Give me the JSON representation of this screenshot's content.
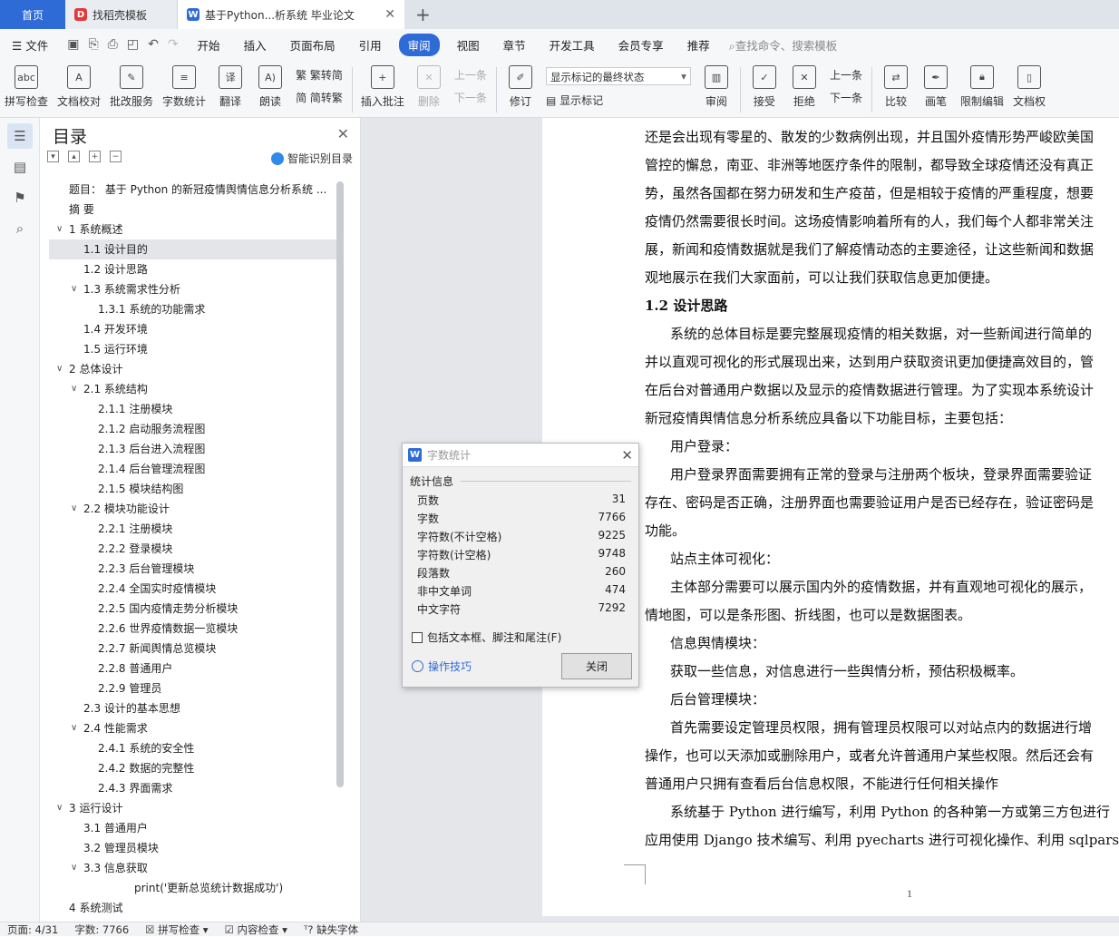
{
  "tabs": [
    {
      "label": "首页",
      "icon": "home-tab"
    },
    {
      "label": "找稻壳模板",
      "icon": "docer-icon"
    },
    {
      "label": "基于Python...析系统 毕业论文",
      "icon": "wps-writer-icon"
    }
  ],
  "menu": {
    "file": "文件",
    "items": [
      "开始",
      "插入",
      "页面布局",
      "引用",
      "审阅",
      "视图",
      "章节",
      "开发工具",
      "会员专享",
      "推荐"
    ],
    "active": "审阅",
    "search_placeholder": "查找命令、搜索模板"
  },
  "ribbon": {
    "spell_check": "拼写检查",
    "doc_proof": "文档校对",
    "batch_service": "批改服务",
    "word_count": "字数统计",
    "translate": "翻译",
    "read_aloud": "朗读",
    "trad_to_simp": "繁转简",
    "simp_to_trad": "简转繁",
    "insert_comment": "插入批注",
    "delete": "删除",
    "prev_comment": "上一条",
    "next_comment": "下一条",
    "track_changes": "修订",
    "markup_select": "显示标记的最终状态",
    "show_markup": "显示标记",
    "review": "审阅",
    "accept": "接受",
    "reject": "拒绝",
    "prev_change": "上一条",
    "next_change": "下一条",
    "compare": "比较",
    "pen": "画笔",
    "restrict_edit": "限制编辑",
    "doc_right": "文档权"
  },
  "toc": {
    "title": "目录",
    "smart_label": "智能识别目录",
    "items": [
      {
        "text": "题目： 基于 Python 的新冠疫情舆情信息分析系统 ...",
        "level": 0,
        "arrow": ""
      },
      {
        "text": "摘   要",
        "level": 0,
        "arrow": ""
      },
      {
        "text": "1   系统概述",
        "level": 0,
        "arrow": "v"
      },
      {
        "text": "1.1   设计目的",
        "level": 1,
        "arrow": "",
        "selected": true
      },
      {
        "text": "1.2  设计思路",
        "level": 1,
        "arrow": ""
      },
      {
        "text": "1.3  系统需求性分析",
        "level": 1,
        "arrow": "v"
      },
      {
        "text": "1.3.1  系统的功能需求",
        "level": 2,
        "arrow": ""
      },
      {
        "text": "1.4  开发环境",
        "level": 1,
        "arrow": ""
      },
      {
        "text": "1.5  运行环境",
        "level": 1,
        "arrow": ""
      },
      {
        "text": "2  总体设计",
        "level": 0,
        "arrow": "v"
      },
      {
        "text": "2.1 系统结构",
        "level": 1,
        "arrow": "v"
      },
      {
        "text": "2.1.1 注册模块",
        "level": 2,
        "arrow": ""
      },
      {
        "text": "2.1.2 启动服务流程图",
        "level": 2,
        "arrow": ""
      },
      {
        "text": "2.1.3 后台进入流程图",
        "level": 2,
        "arrow": ""
      },
      {
        "text": "2.1.4 后台管理流程图",
        "level": 2,
        "arrow": ""
      },
      {
        "text": "2.1.5 模块结构图",
        "level": 2,
        "arrow": ""
      },
      {
        "text": "2.2 模块功能设计",
        "level": 1,
        "arrow": "v"
      },
      {
        "text": "2.2.1 注册模块",
        "level": 2,
        "arrow": ""
      },
      {
        "text": "2.2.2 登录模块",
        "level": 2,
        "arrow": ""
      },
      {
        "text": "2.2.3 后台管理模块",
        "level": 2,
        "arrow": ""
      },
      {
        "text": "2.2.4 全国实时疫情模块",
        "level": 2,
        "arrow": ""
      },
      {
        "text": "2.2.5 国内疫情走势分析模块",
        "level": 2,
        "arrow": ""
      },
      {
        "text": "2.2.6 世界疫情数据一览模块",
        "level": 2,
        "arrow": ""
      },
      {
        "text": "2.2.7 新闻舆情总览模块",
        "level": 2,
        "arrow": ""
      },
      {
        "text": "2.2.8 普通用户",
        "level": 2,
        "arrow": ""
      },
      {
        "text": "2.2.9 管理员",
        "level": 2,
        "arrow": ""
      },
      {
        "text": "2.3 设计的基本思想",
        "level": 1,
        "arrow": ""
      },
      {
        "text": "2.4 性能需求",
        "level": 1,
        "arrow": "v"
      },
      {
        "text": "2.4.1 系统的安全性",
        "level": 2,
        "arrow": ""
      },
      {
        "text": "2.4.2 数据的完整性",
        "level": 2,
        "arrow": ""
      },
      {
        "text": "2.4.3 界面需求",
        "level": 2,
        "arrow": ""
      },
      {
        "text": "3  运行设计",
        "level": 0,
        "arrow": "v"
      },
      {
        "text": "3.1  普通用户",
        "level": 1,
        "arrow": ""
      },
      {
        "text": "3.2  管理员模块",
        "level": 1,
        "arrow": ""
      },
      {
        "text": "3.3  信息获取",
        "level": 1,
        "arrow": "v"
      },
      {
        "text": "print('更新总览统计数据成功')",
        "level": 3,
        "arrow": ""
      },
      {
        "text": "4  系统测试",
        "level": 0,
        "arrow": ""
      }
    ]
  },
  "document": {
    "lines": [
      {
        "text": "还是会出现有零星的、散发的少数病例出现，并且国外疫情形势严峻欧美国",
        "indent": false,
        "heading": false
      },
      {
        "text": "管控的懈怠，南亚、非洲等地医疗条件的限制，都导致全球疫情还没有真正",
        "indent": false,
        "heading": false
      },
      {
        "text": "势，虽然各国都在努力研发和生产疫苗，但是相较于疫情的严重程度，想要",
        "indent": false,
        "heading": false
      },
      {
        "text": "疫情仍然需要很长时间。这场疫情影响着所有的人，我们每个人都非常关注",
        "indent": false,
        "heading": false
      },
      {
        "text": "展，新闻和疫情数据就是我们了解疫情动态的主要途径，让这些新闻和数据",
        "indent": false,
        "heading": false
      },
      {
        "text": "观地展示在我们大家面前，可以让我们获取信息更加便捷。",
        "indent": false,
        "heading": false
      },
      {
        "text": "1.2  设计思路",
        "indent": false,
        "heading": true
      },
      {
        "text": " 系统的总体目标是要完整展现疫情的相关数据，对一些新闻进行简单的",
        "indent": true,
        "heading": false
      },
      {
        "text": "并以直观可视化的形式展现出来，达到用户获取资讯更加便捷高效目的，管",
        "indent": false,
        "heading": false
      },
      {
        "text": "在后台对普通用户数据以及显示的疫情数据进行管理。为了实现本系统设计",
        "indent": false,
        "heading": false
      },
      {
        "text": "新冠疫情舆情信息分析系统应具备以下功能目标，主要包括：",
        "indent": false,
        "heading": false
      },
      {
        "text": "用户登录：",
        "indent": true,
        "heading": false
      },
      {
        "text": "用户登录界面需要拥有正常的登录与注册两个板块，登录界面需要验证",
        "indent": true,
        "heading": false
      },
      {
        "text": "存在、密码是否正确，注册界面也需要验证用户是否已经存在，验证密码是",
        "indent": false,
        "heading": false
      },
      {
        "text": "功能。",
        "indent": false,
        "heading": false
      },
      {
        "text": "站点主体可视化：",
        "indent": true,
        "heading": false
      },
      {
        "text": "主体部分需要可以展示国内外的疫情数据，并有直观地可视化的展示，",
        "indent": true,
        "heading": false
      },
      {
        "text": "情地图，可以是条形图、折线图，也可以是数据图表。",
        "indent": false,
        "heading": false
      },
      {
        "text": "信息舆情模块：",
        "indent": true,
        "heading": false
      },
      {
        "text": "获取一些信息，对信息进行一些舆情分析，预估积极概率。",
        "indent": true,
        "heading": false
      },
      {
        "text": "后台管理模块：",
        "indent": true,
        "heading": false
      },
      {
        "text": "首先需要设定管理员权限，拥有管理员权限可以对站点内的数据进行增",
        "indent": true,
        "heading": false
      },
      {
        "text": "操作，也可以天添加或删除用户，或者允许普通用户某些权限。然后还会有",
        "indent": false,
        "heading": false
      },
      {
        "text": "普通用户只拥有查看后台信息权限，不能进行任何相关操作",
        "indent": false,
        "heading": false
      },
      {
        "text": "系统基于 Python 进行编写，利用 Python 的各种第一方或第三方包进行",
        "indent": true,
        "heading": false
      },
      {
        "text": "应用使用 Django 技术编写、利用 pyecharts 进行可视化操作、利用 sqlparse",
        "indent": false,
        "heading": false
      }
    ],
    "page_number": "1"
  },
  "dialog": {
    "title": "字数统计",
    "section": "统计信息",
    "rows": [
      {
        "label": "页数",
        "value": "31"
      },
      {
        "label": "字数",
        "value": "7766"
      },
      {
        "label": "字符数(不计空格)",
        "value": "9225"
      },
      {
        "label": "字符数(计空格)",
        "value": "9748"
      },
      {
        "label": "段落数",
        "value": "260"
      },
      {
        "label": "非中文单词",
        "value": "474"
      },
      {
        "label": "中文字符",
        "value": "7292"
      }
    ],
    "checkbox_label": "包括文本框、脚注和尾注(F)",
    "tips_label": "操作技巧",
    "close_label": "关闭"
  },
  "status": {
    "page": "页面: 4/31",
    "words": "字数: 7766",
    "spell": "拼写检查",
    "content_check": "内容检查",
    "missing_font": "缺失字体"
  },
  "colors": {
    "accent": "#2f6bd6",
    "docer_red": "#e2393d"
  }
}
